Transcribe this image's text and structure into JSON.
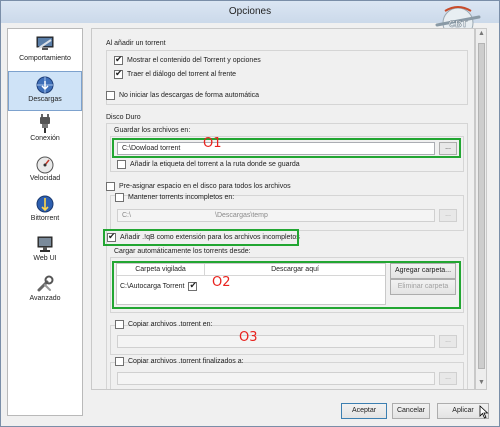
{
  "window": {
    "title": "Opciones"
  },
  "logo": {
    "text": "CBT"
  },
  "sidebar": {
    "items": [
      {
        "label": "Comportamiento",
        "icon": "monitor-icon",
        "selected": false
      },
      {
        "label": "Descargas",
        "icon": "globe-download-icon",
        "selected": true
      },
      {
        "label": "Conexión",
        "icon": "plug-icon",
        "selected": false
      },
      {
        "label": "Velocidad",
        "icon": "speedometer-icon",
        "selected": false
      },
      {
        "label": "Bittorrent",
        "icon": "bittorrent-icon",
        "selected": false
      },
      {
        "label": "Web UI",
        "icon": "web-ui-icon",
        "selected": false
      },
      {
        "label": "Avanzado",
        "icon": "wrench-icon",
        "selected": false
      }
    ]
  },
  "add_torrent": {
    "title": "Al añadir un torrent",
    "show_contents": "Mostrar el contenido del Torrent y opciones",
    "bring_dialog": "Traer el diálogo del torrent al frente",
    "dont_start": "No iniciar las descargas de forma automática"
  },
  "hard_disk": {
    "title": "Disco Duro",
    "save_files_title": "Guardar los archivos en:",
    "save_path": "C:\\Dowload torrent",
    "browse": "...",
    "append_label": "Añadir la etiqueta del torrent a la ruta donde se guarda",
    "preallocate": "Pre-asignar espacio en el disco para todos los archivos",
    "keep_incomplete": "Mantener torrents incompletos en:",
    "incomplete_path_prefix": "C:\\",
    "incomplete_path_suffix": "\\Descargas\\temp",
    "append_qb": "Añadir .!qB como extensión para los archivos incompletos",
    "autoload_title": "Cargar automáticamente los torrents desde:",
    "table_headers": [
      "Carpeta vigilada",
      "Descargar aquí"
    ],
    "watched_folder": "C:\\Autocarga Torrent",
    "add_folder": "Agregar carpeta...",
    "remove_folder": "Eliminar carpeta",
    "copy_torrent": "Copiar archivos .torrent en:",
    "copy_finished": "Copiar archivos .torrent finalizados a:"
  },
  "annotations": {
    "mark1": "O1",
    "mark2": "O2",
    "mark3": "O3"
  },
  "buttons": {
    "accept": "Aceptar",
    "cancel": "Cancelar",
    "apply": "Aplicar"
  },
  "colors": {
    "highlight_green": "#22a632",
    "annotation_red": "#e8231e",
    "selection_blue": "#cfe3f7"
  }
}
